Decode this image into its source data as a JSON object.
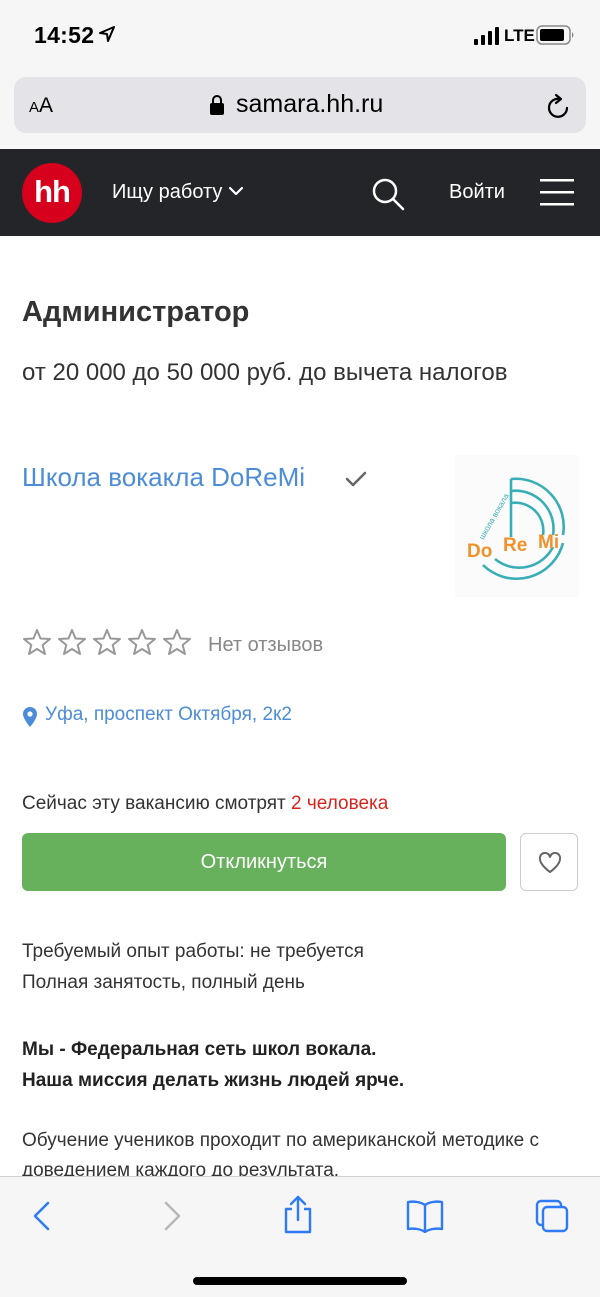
{
  "status_bar": {
    "time": "14:52",
    "network": "LTE"
  },
  "browser": {
    "text_size_small": "A",
    "text_size_big": "A",
    "domain": "samara.hh.ru"
  },
  "header": {
    "logo": "hh",
    "search_job": "Ищу работу",
    "login": "Войти"
  },
  "vacancy": {
    "title": "Администратор",
    "salary": "от 20 000 до 50 000 руб. до вычета налогов",
    "company": "Школа вокакла DoReMi",
    "company_logo": {
      "tagline": "школа вокала",
      "do": "Do",
      "re": "Re",
      "mi": "Mi"
    },
    "rating_stars": 0,
    "reviews": "Нет отзывов",
    "address": "Уфа, проспект Октября, 2к2",
    "watching_prefix": "Сейчас эту вакансию смотрят",
    "watching_count": "2 человека",
    "apply_button": "Откликнуться",
    "experience": "Требуемый опыт работы: не требуется",
    "employment": "Полная занятость, полный день",
    "bold_line_1": "Мы - Федеральная сеть школ вокала.",
    "bold_line_2": "Наша миссия делать жизнь людей ярче.",
    "description_1": "Обучение учеников проходит по американской методике с",
    "description_2": "доведением каждого до результата."
  },
  "colors": {
    "hh_red": "#d6001c",
    "link_blue": "#4d8cd7",
    "apply_green": "#68b15c",
    "header_dark": "#232529",
    "accent_red": "#d6251c"
  },
  "toolbar_icons": [
    "back-icon",
    "forward-icon",
    "share-icon",
    "bookmarks-icon",
    "tabs-icon"
  ]
}
